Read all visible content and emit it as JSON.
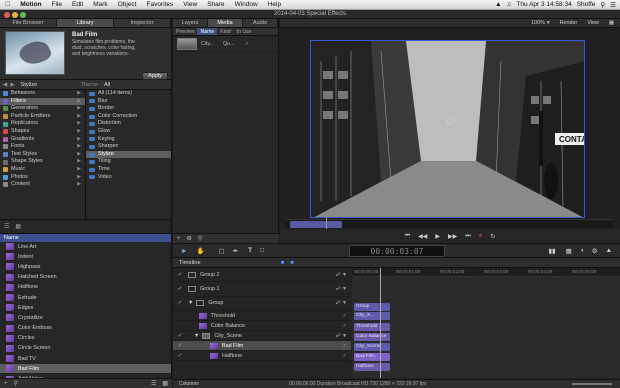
{
  "menubar": {
    "apple": "",
    "items": [
      "Motion",
      "File",
      "Edit",
      "Mark",
      "Object",
      "Favorites",
      "View",
      "Share",
      "Window",
      "Help"
    ],
    "clock": "Thu Apr 3  14:58:34",
    "user": "Shoffe"
  },
  "window": {
    "title": "2014-04-03 Special Effects"
  },
  "left_tabs": [
    "File Browser",
    "Library",
    "Inspector"
  ],
  "library": {
    "preview_title": "Bad Film",
    "preview_desc": "Simulates film problems, the dust, scratches, color fading, and brightness variations.",
    "apply_label": "Apply",
    "filter_left": "Stylize",
    "filter_right_label": "Theme",
    "filter_right_value": "All",
    "categories": [
      {
        "label": "Behaviors",
        "color": "#4f86d9"
      },
      {
        "label": "Filters",
        "color": "#7a5ccf",
        "selected": true
      },
      {
        "label": "Generators",
        "color": "#5b8f46"
      },
      {
        "label": "Particle Emitters",
        "color": "#c98a3a"
      },
      {
        "label": "Replicators",
        "color": "#3fa59a"
      },
      {
        "label": "Shapes",
        "color": "#d24b4b"
      },
      {
        "label": "Gradients",
        "color": "#b45fb0"
      },
      {
        "label": "Fonts",
        "color": "#888888"
      },
      {
        "label": "Text Styles",
        "color": "#5e7fc9"
      },
      {
        "label": "Shape Styles",
        "color": "#6c6c6c"
      },
      {
        "label": "Music",
        "color": "#d0a13a"
      },
      {
        "label": "Photos",
        "color": "#4aa0d8"
      },
      {
        "label": "Content",
        "color": "#8a8a8a"
      }
    ],
    "subcategories": [
      {
        "label": "All (114 items)"
      },
      {
        "label": "Blur"
      },
      {
        "label": "Border"
      },
      {
        "label": "Color Correction"
      },
      {
        "label": "Distortion"
      },
      {
        "label": "Glow"
      },
      {
        "label": "Keying"
      },
      {
        "label": "Sharpen"
      },
      {
        "label": "Stylize",
        "selected": true
      },
      {
        "label": "Tiling"
      },
      {
        "label": "Time"
      },
      {
        "label": "Video"
      }
    ],
    "name_header": "Name",
    "filters": [
      {
        "label": "Line Art"
      },
      {
        "label": "Indent"
      },
      {
        "label": "Highpass"
      },
      {
        "label": "Hatched Screen"
      },
      {
        "label": "Halftone"
      },
      {
        "label": "Extrude"
      },
      {
        "label": "Edges"
      },
      {
        "label": "Crystallize"
      },
      {
        "label": "Color Emboss"
      },
      {
        "label": "Circles"
      },
      {
        "label": "Circle Screen"
      },
      {
        "label": "Bad TV"
      },
      {
        "label": "Bad Film",
        "selected": true
      },
      {
        "label": "Add Noise"
      }
    ]
  },
  "layers_tabs": [
    "Layers",
    "Media",
    "Audio"
  ],
  "media_cols": [
    "Preview",
    "Name",
    "Kind",
    "In Use"
  ],
  "media_row": {
    "name": "City...",
    "kind": "Qu...",
    "inuse": "✓"
  },
  "canvas": {
    "zoom": "100%",
    "render": "Render",
    "view": "View"
  },
  "timecode": "00:00:03:07",
  "timeline": {
    "title": "Timeline",
    "rows": [
      {
        "label": "Group 2",
        "indent": 0,
        "type": "group"
      },
      {
        "label": "Group 1",
        "indent": 0,
        "type": "group"
      },
      {
        "label": "Group",
        "indent": 0,
        "type": "group",
        "expanded": true
      },
      {
        "label": "Threshold",
        "indent": 1,
        "type": "filter"
      },
      {
        "label": "Color Balance",
        "indent": 1,
        "type": "filter"
      },
      {
        "label": "City_Scene",
        "indent": 1,
        "type": "clip",
        "expanded": true
      },
      {
        "label": "Bad Film",
        "indent": 2,
        "type": "filter",
        "selected": true
      },
      {
        "label": "Halftone",
        "indent": 2,
        "type": "filter"
      }
    ],
    "ruler_ticks": [
      "00:00:00:00",
      "00:00:01:00",
      "00:00:02:00",
      "00:00:03:00",
      "00:00:04:00",
      "00:00:05:00"
    ],
    "tracks": [
      {
        "label": "Group",
        "row": 2,
        "color": "#5d5ba8"
      },
      {
        "label": "City_S...",
        "row": 3,
        "color": "#5d5ba8"
      },
      {
        "label": "Threshold",
        "row": 4,
        "color": "#6b5aa8"
      },
      {
        "label": "Color Balance",
        "row": 5,
        "color": "#6b5aa8"
      },
      {
        "label": "City_Scene",
        "row": 6,
        "color": "#5d5ba8"
      },
      {
        "label": "Bad Film",
        "row": 7,
        "color": "#7e62c6"
      },
      {
        "label": "Halftone",
        "row": 8,
        "color": "#6b5aa8"
      }
    ],
    "footer_left": "Columns",
    "footer_status": "00:00:06:00  Duration  Broadcast HD 720  1280 × 720  29.97 fps"
  }
}
